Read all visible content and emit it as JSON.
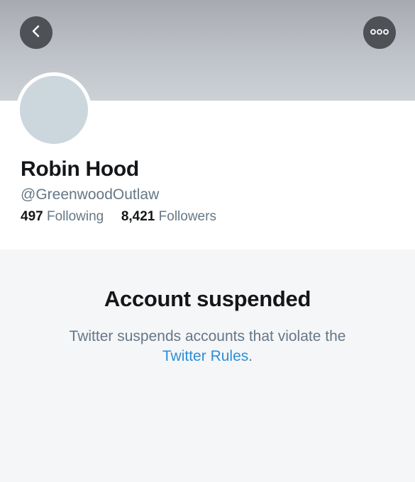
{
  "header": {
    "back_icon": "chevron-left-icon",
    "more_icon": "more-horizontal-icon"
  },
  "profile": {
    "name": "Robin Hood",
    "handle": "@GreenwoodOutlaw",
    "following_count": "497",
    "following_label": "Following",
    "followers_count": "8,421",
    "followers_label": "Followers"
  },
  "notice": {
    "title": "Account suspended",
    "text": "Twitter suspends accounts that violate the",
    "link": "Twitter Rules",
    "period": "."
  },
  "colors": {
    "banner": "#bfc3c9",
    "button_bg": "#4e5257",
    "link": "#2b8fd6",
    "muted_text": "#657786",
    "primary_text": "#14171a"
  }
}
